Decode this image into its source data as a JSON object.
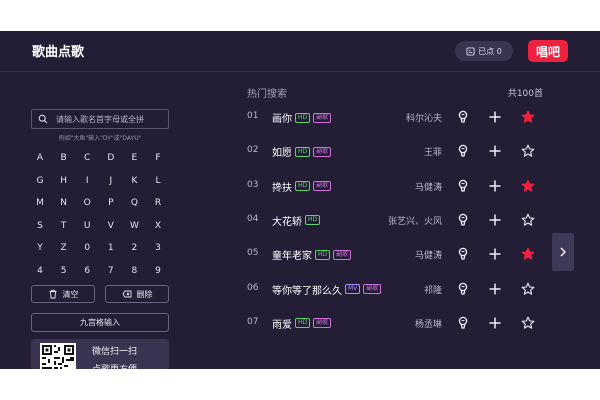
{
  "header": {
    "title": "歌曲点歌",
    "ordered_label": "已点 0",
    "logo_text": "唱吧"
  },
  "search": {
    "placeholder": "请输入歌名首字母或全拼",
    "hint": "例如\"大鱼\"输入\"DY\"或\"DAYU\""
  },
  "keypad": {
    "keys": [
      "A",
      "B",
      "C",
      "D",
      "E",
      "F",
      "G",
      "H",
      "I",
      "J",
      "K",
      "L",
      "M",
      "N",
      "O",
      "P",
      "Q",
      "R",
      "S",
      "T",
      "U",
      "V",
      "W",
      "X",
      "Y",
      "Z",
      "0",
      "1",
      "2",
      "3",
      "4",
      "5",
      "6",
      "7",
      "8",
      "9"
    ]
  },
  "actions": {
    "clear_label": "清空",
    "delete_label": "删除",
    "nine_grid_label": "九宫格输入"
  },
  "qr": {
    "line1": "微信扫一扫",
    "line2": "点歌更方便"
  },
  "list": {
    "heading": "热门搜索",
    "total": "共100首",
    "songs": [
      {
        "num": "01",
        "title": "画你",
        "tags": [
          "HD",
          "副歌"
        ],
        "artist": "科尔沁夫",
        "favorited": true
      },
      {
        "num": "02",
        "title": "如愿",
        "tags": [
          "HD",
          "副歌"
        ],
        "artist": "王菲",
        "favorited": false
      },
      {
        "num": "03",
        "title": "搀扶",
        "tags": [
          "HD",
          "副歌"
        ],
        "artist": "马健涛",
        "favorited": true
      },
      {
        "num": "04",
        "title": "大花轿",
        "tags": [
          "HD"
        ],
        "artist": "张艺兴、火风",
        "favorited": false
      },
      {
        "num": "05",
        "title": "童年老家",
        "tags": [
          "HD",
          "副歌"
        ],
        "artist": "马健涛",
        "favorited": true
      },
      {
        "num": "06",
        "title": "等你等了那么久",
        "tags": [
          "MV",
          "副歌"
        ],
        "artist": "祁隆",
        "favorited": false
      },
      {
        "num": "07",
        "title": "雨爱",
        "tags": [
          "HD",
          "副歌"
        ],
        "artist": "杨丞琳",
        "favorited": false
      }
    ]
  },
  "colors": {
    "background": "#231d35",
    "accent_red": "#f0213f",
    "hd_tag": "#5fd26a",
    "chorus_tag": "#d070d8",
    "mv_tag": "#a890ff"
  }
}
